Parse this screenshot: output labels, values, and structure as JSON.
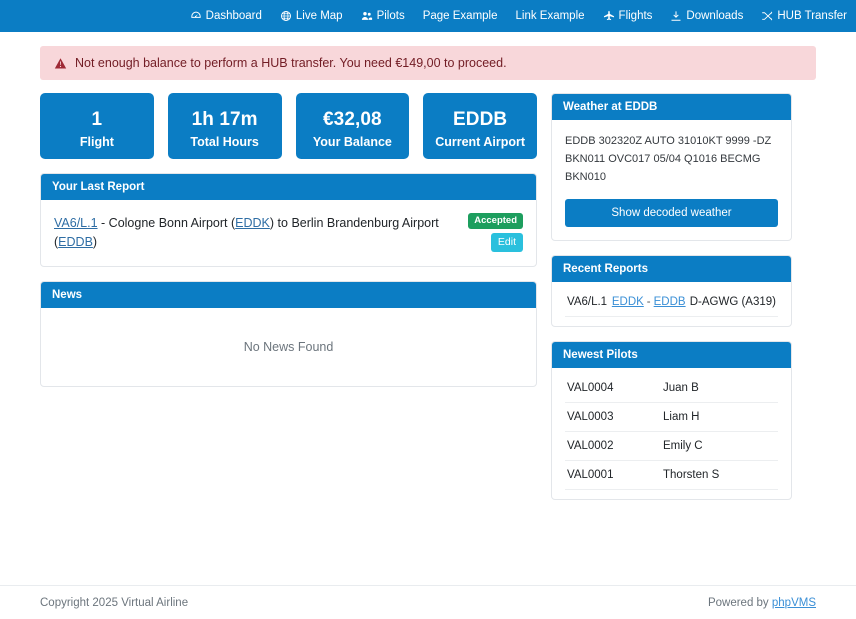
{
  "navbar": {
    "items": [
      {
        "label": "Dashboard",
        "icon": "dashboard-icon"
      },
      {
        "label": "Live Map",
        "icon": "globe-icon"
      },
      {
        "label": "Pilots",
        "icon": "pilots-icon"
      },
      {
        "label": "Page Example",
        "icon": "none"
      },
      {
        "label": "Link Example",
        "icon": "none"
      },
      {
        "label": "Flights",
        "icon": "plane-icon"
      },
      {
        "label": "Downloads",
        "icon": "download-icon"
      },
      {
        "label": "HUB Transfer",
        "icon": "transfer-icon"
      }
    ]
  },
  "alert": {
    "icon": "warning-triangle-icon",
    "message": "Not enough balance to perform a HUB transfer. You need €149,00 to proceed.",
    "background": "#f8d7da",
    "text_color": "#721c24"
  },
  "stats": [
    {
      "value": "1",
      "label": "Flight"
    },
    {
      "value": "1h 17m",
      "label": "Total Hours"
    },
    {
      "value": "€32,08",
      "label": "Your Balance"
    },
    {
      "value": "EDDB",
      "label": "Current Airport"
    }
  ],
  "last_report": {
    "title": "Your Last Report",
    "flight_number": "VA6/L.1",
    "dash": " - ",
    "departure_name": "Cologne Bonn Airport",
    "departure_open": " (",
    "departure_code": "EDDK",
    "mid": ") to ",
    "arrival_name": "Berlin Brandenburg Airport",
    "arrival_open": " (",
    "arrival_code": "EDDB",
    "arrival_close": ")",
    "status_badge": "Accepted",
    "edit_label": "Edit",
    "badge_color": "#1d9e5e",
    "edit_color": "#2ac0dd"
  },
  "news": {
    "title": "News",
    "empty_text": "No News Found"
  },
  "weather": {
    "title": "Weather at EDDB",
    "metar": "EDDB 302320Z AUTO 31010KT 9999 -DZ BKN011 OVC017 05/04 Q1016 BECMG BKN010",
    "button_label": "Show decoded weather"
  },
  "recent_reports": {
    "title": "Recent Reports",
    "rows": [
      {
        "flight": "VA6/L.1",
        "from": "EDDK",
        "separator": "-",
        "to": "EDDB",
        "aircraft": "D-AGWG (A319)"
      }
    ]
  },
  "newest_pilots": {
    "title": "Newest Pilots",
    "rows": [
      {
        "code": "VAL0004",
        "name": "Juan B"
      },
      {
        "code": "VAL0003",
        "name": "Liam H"
      },
      {
        "code": "VAL0002",
        "name": "Emily C"
      },
      {
        "code": "VAL0001",
        "name": "Thorsten S"
      }
    ]
  },
  "footer": {
    "copyright": "Copyright 2025 Virtual Airline",
    "powered_prefix": "Powered by ",
    "powered_link": "phpVMS"
  },
  "theme": {
    "primary": "#0b7dc4",
    "link": "#2e6da4"
  }
}
